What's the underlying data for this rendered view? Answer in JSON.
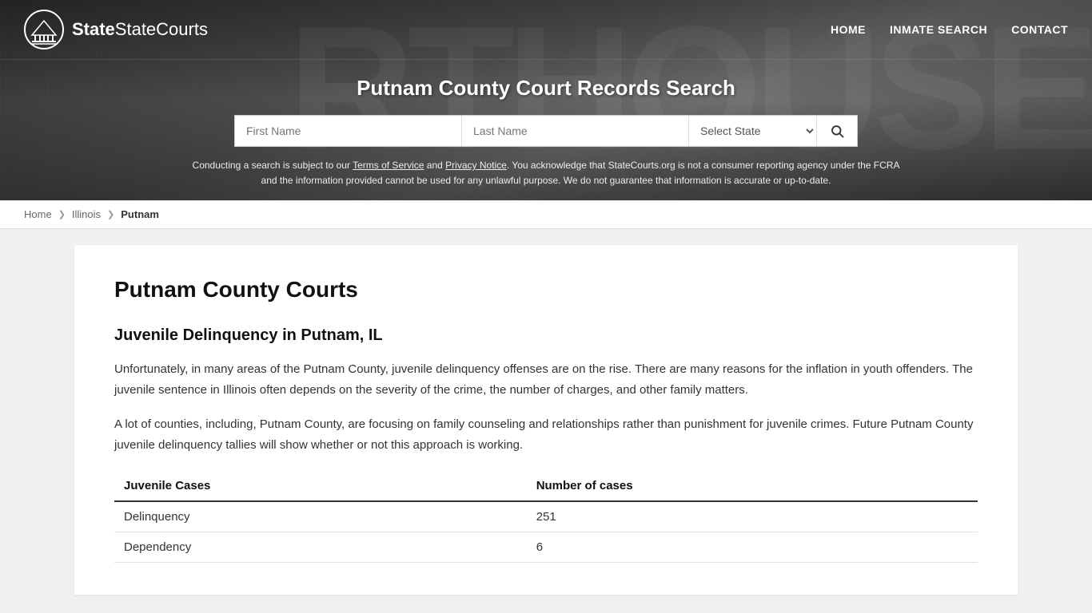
{
  "site": {
    "name": "StateCourts",
    "logo_alt": "StateCourts logo"
  },
  "nav": {
    "home_label": "HOME",
    "inmate_search_label": "INMATE SEARCH",
    "contact_label": "CONTACT"
  },
  "hero": {
    "title": "Putnam County Court Records Search",
    "first_name_placeholder": "First Name",
    "last_name_placeholder": "Last Name",
    "select_state_label": "Select State",
    "search_button_label": "Search",
    "disclaimer": "Conducting a search is subject to our Terms of Service and Privacy Notice. You acknowledge that StateCourts.org is not a consumer reporting agency under the FCRA and the information provided cannot be used for any unlawful purpose. We do not guarantee that information is accurate or up-to-date.",
    "terms_label": "Terms of Service",
    "privacy_label": "Privacy Notice"
  },
  "breadcrumb": {
    "home": "Home",
    "state": "Illinois",
    "current": "Putnam"
  },
  "main": {
    "page_title": "Putnam County Courts",
    "section_title": "Juvenile Delinquency in Putnam, IL",
    "paragraph1": "Unfortunately, in many areas of the Putnam County, juvenile delinquency offenses are on the rise. There are many reasons for the inflation in youth offenders. The juvenile sentence in Illinois often depends on the severity of the crime, the number of charges, and other family matters.",
    "paragraph2": "A lot of counties, including, Putnam County, are focusing on family counseling and relationships rather than punishment for juvenile crimes. Future Putnam County juvenile delinquency tallies will show whether or not this approach is working.",
    "table": {
      "col1_header": "Juvenile Cases",
      "col2_header": "Number of cases",
      "rows": [
        {
          "label": "Delinquency",
          "value": "251"
        },
        {
          "label": "Dependency",
          "value": "6"
        }
      ]
    }
  }
}
